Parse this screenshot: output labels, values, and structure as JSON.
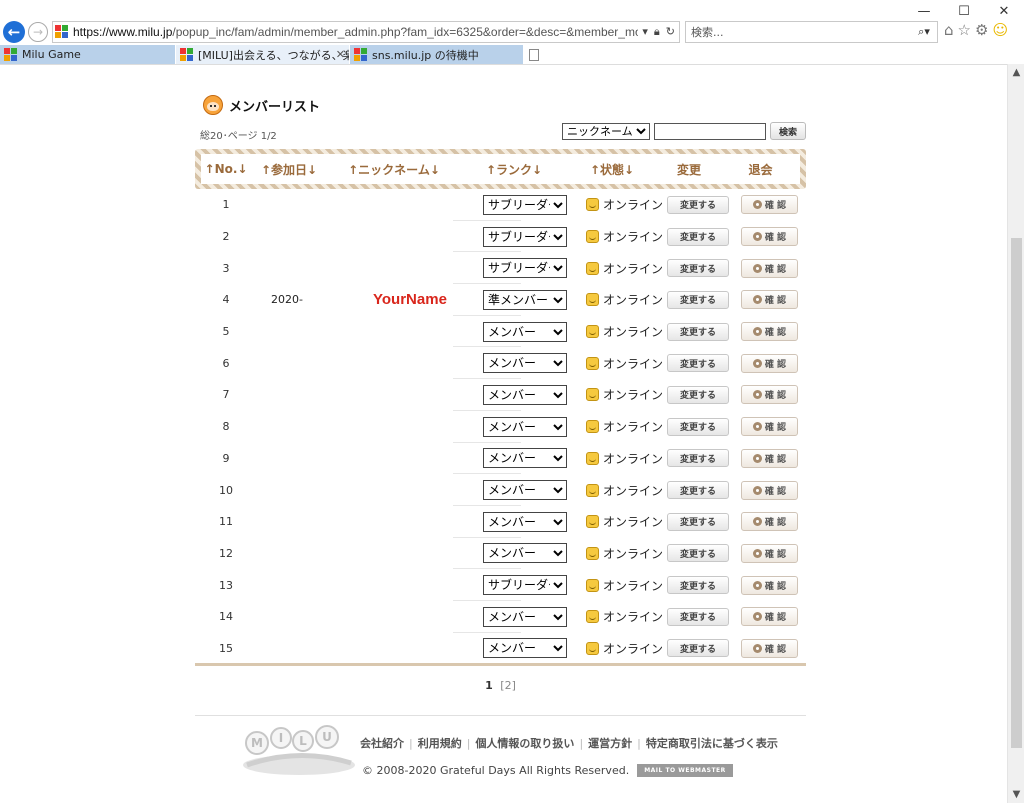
{
  "browser": {
    "url_domain": "https://www.milu.jp",
    "url_path": "/popup_inc/fam/admin/member_admin.php?fam_idx=6325&order=&desc=&member_mode=&search",
    "search_placeholder": "検索...",
    "tabs": [
      {
        "label": "Milu Game"
      },
      {
        "label": "[MILU]出会える、つながる、楽し..."
      },
      {
        "label": "sns.milu.jp の待機中"
      }
    ]
  },
  "page": {
    "title": "メンバーリスト",
    "page_info": "総20･ページ 1/2",
    "filter": {
      "selected": "ニックネーム",
      "value": "",
      "search_label": "検索"
    },
    "headers": {
      "no": "↑No.↓",
      "joined": "↑参加日↓",
      "nickname": "↑ニックネーム↓",
      "rank": "↑ランク↓",
      "status": "↑状態↓",
      "change": "変更",
      "leave": "退会"
    },
    "merged": {
      "date": "2020-",
      "nickname": "YourName"
    },
    "rows": [
      {
        "no": "1",
        "rank": "サブリーダー",
        "status": "オンライン",
        "change": "変更する",
        "confirm": "確 認"
      },
      {
        "no": "2",
        "rank": "サブリーダー",
        "status": "オンライン",
        "change": "変更する",
        "confirm": "確 認"
      },
      {
        "no": "3",
        "rank": "サブリーダー",
        "status": "オンライン",
        "change": "変更する",
        "confirm": "確 認"
      },
      {
        "no": "4",
        "rank": "準メンバー",
        "status": "オンライン",
        "change": "変更する",
        "confirm": "確 認"
      },
      {
        "no": "5",
        "rank": "メンバー",
        "status": "オンライン",
        "change": "変更する",
        "confirm": "確 認"
      },
      {
        "no": "6",
        "rank": "メンバー",
        "status": "オンライン",
        "change": "変更する",
        "confirm": "確 認"
      },
      {
        "no": "7",
        "rank": "メンバー",
        "status": "オンライン",
        "change": "変更する",
        "confirm": "確 認"
      },
      {
        "no": "8",
        "rank": "メンバー",
        "status": "オンライン",
        "change": "変更する",
        "confirm": "確 認"
      },
      {
        "no": "9",
        "rank": "メンバー",
        "status": "オンライン",
        "change": "変更する",
        "confirm": "確 認"
      },
      {
        "no": "10",
        "rank": "メンバー",
        "status": "オンライン",
        "change": "変更する",
        "confirm": "確 認"
      },
      {
        "no": "11",
        "rank": "メンバー",
        "status": "オンライン",
        "change": "変更する",
        "confirm": "確 認"
      },
      {
        "no": "12",
        "rank": "メンバー",
        "status": "オンライン",
        "change": "変更する",
        "confirm": "確 認"
      },
      {
        "no": "13",
        "rank": "サブリーダー",
        "status": "オンライン",
        "change": "変更する",
        "confirm": "確 認"
      },
      {
        "no": "14",
        "rank": "メンバー",
        "status": "オンライン",
        "change": "変更する",
        "confirm": "確 認"
      },
      {
        "no": "15",
        "rank": "メンバー",
        "status": "オンライン",
        "change": "変更する",
        "confirm": "確 認"
      }
    ],
    "pager": {
      "current": "1",
      "next": "[2]"
    },
    "footer": {
      "links": [
        "会社紹介",
        "利用規約",
        "個人情報の取り扱い",
        "運営方針",
        "特定商取引法に基づく表示"
      ],
      "copyright": "© 2008-2020 Grateful Days All Rights Reserved.",
      "mail_button": "MAIL TO WEBMASTER"
    }
  }
}
